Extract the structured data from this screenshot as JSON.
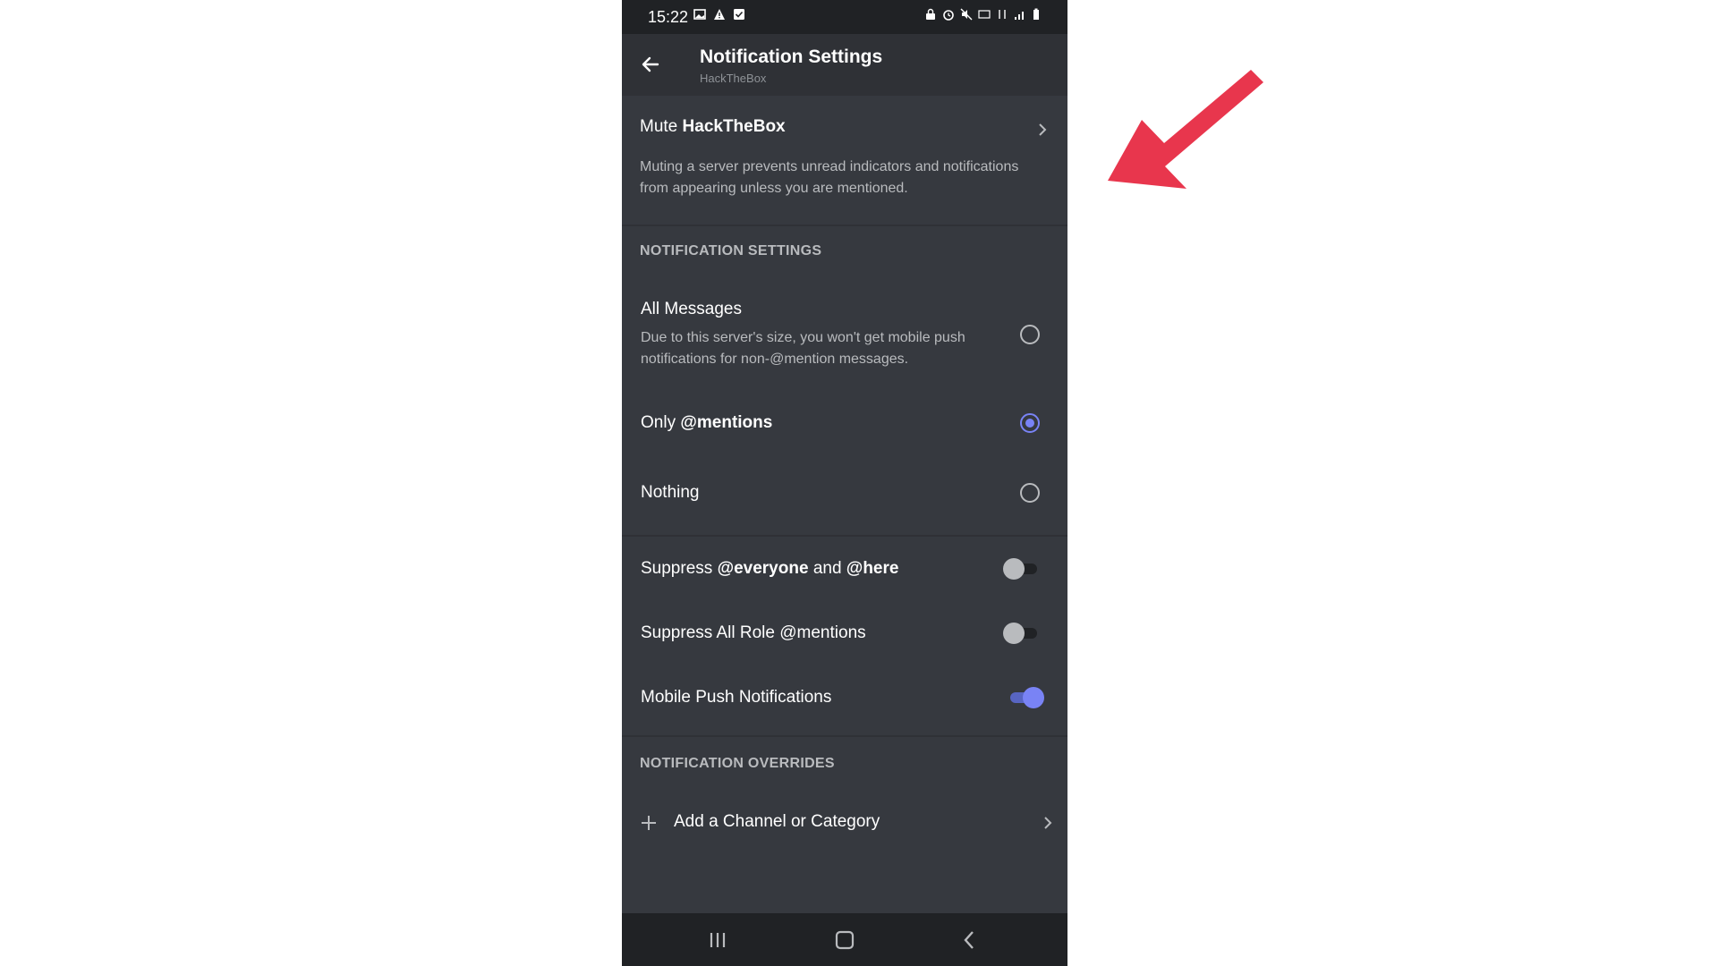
{
  "status_bar": {
    "time": "15:22"
  },
  "header": {
    "title": "Notification Settings",
    "subtitle": "HackTheBox"
  },
  "mute": {
    "prefix": "Mute",
    "server": "HackTheBox",
    "description": "Muting a server prevents unread indicators and notifications from appearing unless you are mentioned."
  },
  "notification_settings": {
    "label": "NOTIFICATION SETTINGS",
    "options": [
      {
        "title": "All Messages",
        "description": "Due to this server's size, you won't get mobile push notifications for non-@mention messages.",
        "selected": false
      },
      {
        "title_plain": "Only",
        "title_bold": "@mentions",
        "selected": true
      },
      {
        "title": "Nothing",
        "selected": false
      }
    ]
  },
  "toggles": {
    "suppress_everyone": {
      "pre": "Suppress",
      "b1": "@everyone",
      "mid": "and",
      "b2": "@here",
      "on": false
    },
    "suppress_roles": {
      "label": "Suppress All Role @mentions",
      "on": false
    },
    "mobile_push": {
      "label": "Mobile Push Notifications",
      "on": true
    }
  },
  "overrides": {
    "label": "NOTIFICATION OVERRIDES",
    "add_label": "Add a Channel or Category"
  },
  "colors": {
    "accent": "#7983f5",
    "background": "#36393f",
    "header": "#2f3136",
    "annotation_arrow": "#e8364d"
  }
}
